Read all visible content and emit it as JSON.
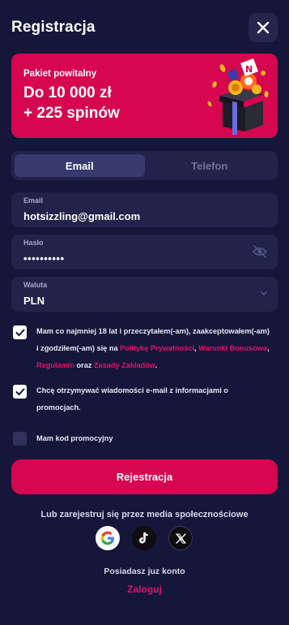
{
  "header": {
    "title": "Registracja"
  },
  "promo": {
    "subtitle": "Pakiet powitalny",
    "line1": "Do 10 000 zł",
    "line2": "+ 225 spinów"
  },
  "tabs": [
    {
      "label": "Email",
      "active": true
    },
    {
      "label": "Telefon",
      "active": false
    }
  ],
  "form": {
    "email": {
      "label": "Email",
      "value": "hotsizzling@gmail.com"
    },
    "password": {
      "label": "Hasło",
      "value": "••••••••••"
    },
    "currency": {
      "label": "Waluta",
      "value": "PLN"
    }
  },
  "consents": {
    "terms": {
      "checked": true,
      "text_before": "Mam co najmniej 18 lat i przeczytałem(-am), zaakceptowałem(-am) i zgodziłem(-am) się na ",
      "link_privacy": "Politykę Prywatności",
      "sep1": ", ",
      "link_bonus": "Warunki Bonusowe",
      "sep2": ", ",
      "link_rules": "Regulamin",
      "and": " oraz ",
      "link_betting": "Zasady Zakładów",
      "end": "."
    },
    "marketing": {
      "checked": true,
      "text": "Chcę otrzymywać wiadomości e-mail z informacjami o promocjach."
    },
    "promo_code": {
      "checked": false,
      "text": "Mam kod promocyjny"
    }
  },
  "submit_label": "Rejestracja",
  "social": {
    "title": "Lub zarejestruj się przez media społecznościowe",
    "icons": [
      "google-icon",
      "tiktok-icon",
      "x-icon"
    ]
  },
  "footer": {
    "have_account": "Posiadasz juz konto",
    "login_label": "Zaloguj"
  },
  "colors": {
    "background": "#15163a",
    "surface": "#22234a",
    "accent": "#d6064f",
    "link": "#e3136a"
  }
}
